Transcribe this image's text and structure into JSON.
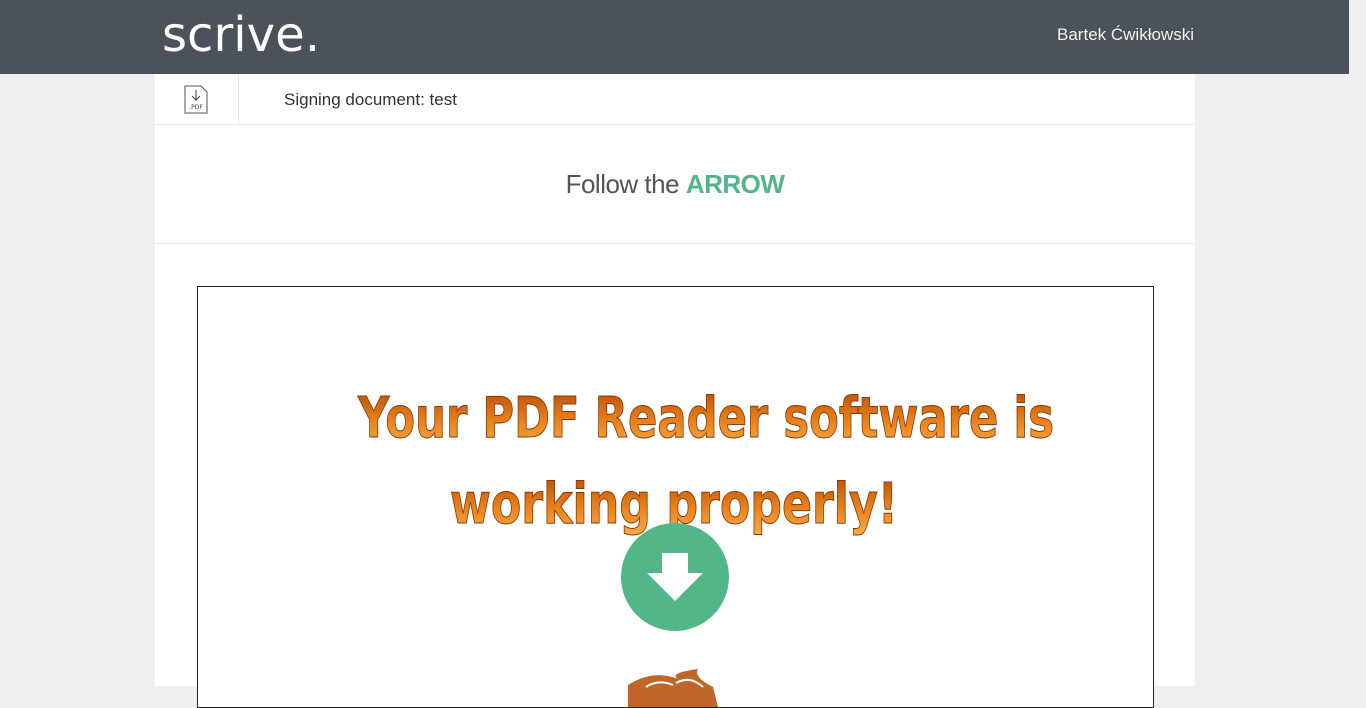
{
  "header": {
    "logo_text": "scrive.",
    "user_name": "Bartek Ćwikłowski"
  },
  "document": {
    "download_icon_label": ".PDF",
    "title": "Signing document: test"
  },
  "instruction": {
    "prefix": "Follow the",
    "emphasis": "ARROW"
  },
  "pdf_page": {
    "line1": "Your PDF Reader software is",
    "line2": "working properly!"
  },
  "colors": {
    "topbar": "#4b525a",
    "accent": "#53b688",
    "page_text_gradient_top": "#c85a0a",
    "page_text_gradient_bottom": "#f6a33c"
  }
}
